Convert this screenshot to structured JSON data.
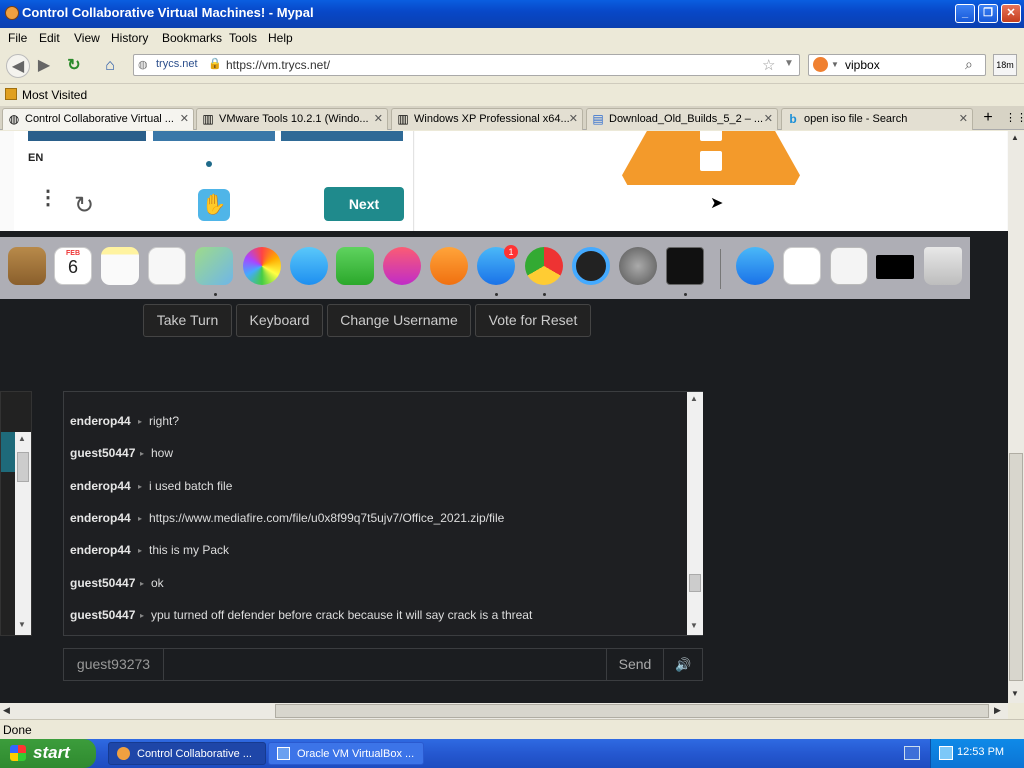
{
  "window": {
    "title": "Control Collaborative Virtual Machines! - Mypal"
  },
  "menubar": {
    "items": [
      "File",
      "Edit",
      "View",
      "History",
      "Bookmarks",
      "Tools",
      "Help"
    ]
  },
  "navbar": {
    "site_identity": "trycs.net",
    "url": "https://vm.trycs.net/",
    "search_value": "vipbox",
    "addon_badge": "18m"
  },
  "bookmarks": {
    "most_visited": "Most Visited"
  },
  "tabs": [
    {
      "label": "Control Collaborative Virtual ..."
    },
    {
      "label": "VMware Tools 10.2.1 (Windo..."
    },
    {
      "label": "Windows XP Professional x64..."
    },
    {
      "label": "Download_Old_Builds_5_2 – ..."
    },
    {
      "label": "open iso file - Search"
    }
  ],
  "vm": {
    "lang": "EN",
    "next_label": "Next",
    "calendar_month": "FEB",
    "calendar_day": "6",
    "appstore_badge": "1",
    "controls": [
      "Take Turn",
      "Keyboard",
      "Change Username",
      "Vote for Reset"
    ]
  },
  "chat": {
    "messages": [
      {
        "user": "enderop44",
        "text": "right?"
      },
      {
        "user": "guest50447",
        "text": "how"
      },
      {
        "user": "enderop44",
        "text": "i used batch file"
      },
      {
        "user": "enderop44",
        "text": "https://www.mediafire.com/file/u0x8f99q7t5ujv7/Office_2021.zip/file"
      },
      {
        "user": "enderop44",
        "text": "this is my Pack"
      },
      {
        "user": "guest50447",
        "text": "ok"
      },
      {
        "user": "guest50447",
        "text": "ypu turned off defender before crack because it will say crack is a threat"
      }
    ],
    "username": "guest93273",
    "send_label": "Send"
  },
  "status": {
    "text": "Done"
  },
  "taskbar": {
    "start_label": "start",
    "tasks": [
      "Control Collaborative ...",
      "Oracle VM VirtualBox ..."
    ],
    "clock": "12:53 PM"
  },
  "colors": {
    "titlebar": "#0a5ee0",
    "next_button": "#1f8a8c",
    "chat_bg": "#1e1f22",
    "taskbar": "#2558d0"
  }
}
